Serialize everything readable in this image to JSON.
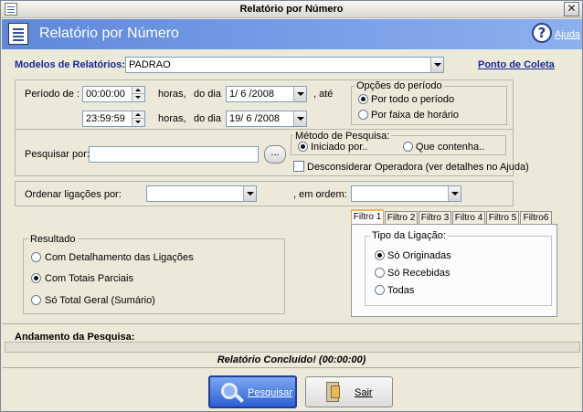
{
  "window": {
    "title": "Relatório por Número"
  },
  "header": {
    "title": "Relatório por Número",
    "help_label": "Ajuda"
  },
  "models": {
    "label": "Modelos de Relatórios:",
    "value": "PADRAO",
    "collect_point": "Ponto de Coleta"
  },
  "period": {
    "label": "Período de :",
    "start_time": "00:00:00",
    "end_time": "23:59:59",
    "hours_label": "horas,",
    "day_label": "do dia",
    "start_date": "1/ 6 /2008",
    "end_date": "19/ 6 /2008",
    "until_label": ", até"
  },
  "period_options": {
    "title": "Opções do período",
    "options": [
      "Por todo o período",
      "Por faixa de horário"
    ],
    "selected": 0
  },
  "search": {
    "label": "Pesquisar por:",
    "value": "",
    "browse_label": "...",
    "method_title": "Método de Pesquisa:",
    "methods": [
      "Iniciado por..",
      "Que contenha.."
    ],
    "selected_method": 0,
    "ignore_operator_label": "Desconsiderar Operadora (ver detalhes no Ajuda)",
    "ignore_operator_checked": false
  },
  "order": {
    "label": "Ordenar ligações por:",
    "value": "",
    "order_label": ", em ordem:",
    "order_value": ""
  },
  "result": {
    "title": "Resultado",
    "options": [
      "Com Detalhamento das Ligações",
      "Com Totais  Parciais",
      "Só Total  Geral (Sumário)"
    ],
    "selected": 1
  },
  "filters": {
    "tabs": [
      "Filtro 1",
      "Filtro 2",
      "Filtro 3",
      "Filtro 4",
      "Filtro 5",
      "Filtro6"
    ],
    "active": 0,
    "call_type_title": "Tipo da Ligação:",
    "call_types": [
      "Só Originadas",
      "Só Recebidas",
      "Todas"
    ],
    "selected_call_type": 0
  },
  "progress": {
    "label": "Andamento da Pesquisa:",
    "status": "Relatório Concluído! (00:00:00)"
  },
  "buttons": {
    "search": "Pesquisar",
    "exit": "Sair"
  },
  "colors": {
    "accent": "#17289a",
    "header": "#6f96e3"
  }
}
